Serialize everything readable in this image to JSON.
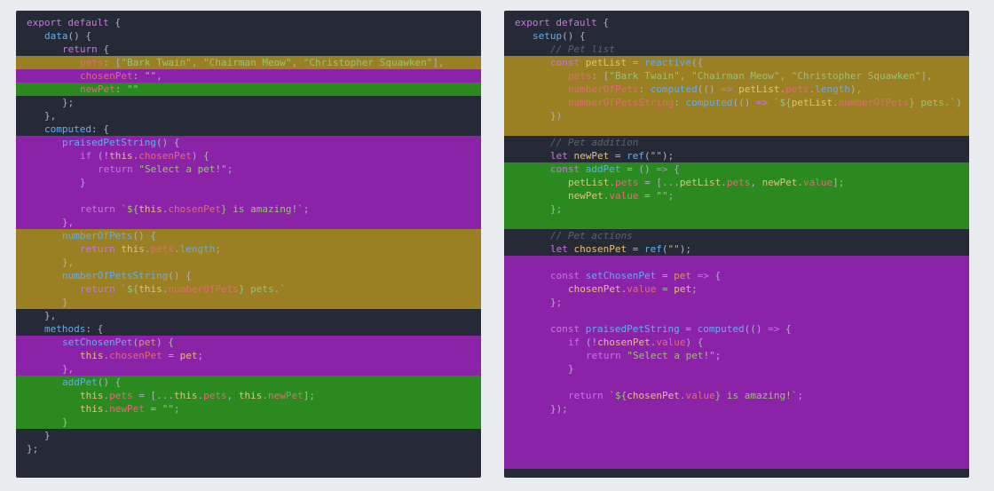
{
  "left": {
    "bands": [
      {
        "from": 3,
        "to": 3,
        "color": "hl-yellow"
      },
      {
        "from": 4,
        "to": 4,
        "color": "hl-purple"
      },
      {
        "from": 5,
        "to": 5,
        "color": "hl-green"
      },
      {
        "from": 9,
        "to": 15,
        "color": "hl-purple"
      },
      {
        "from": 16,
        "to": 18,
        "color": "hl-yellow"
      },
      {
        "from": 19,
        "to": 21,
        "color": "hl-yellow"
      },
      {
        "from": 24,
        "to": 26,
        "color": "hl-purple"
      },
      {
        "from": 27,
        "to": 30,
        "color": "hl-green"
      }
    ],
    "lines": [
      {
        "i": 4,
        "seg": [
          [
            "k",
            "export"
          ],
          [
            "p",
            " "
          ],
          [
            "k",
            "default"
          ],
          [
            "p",
            " {"
          ]
        ]
      },
      {
        "i": 24,
        "seg": [
          [
            "fn",
            "data"
          ],
          [
            "p",
            "() {"
          ]
        ]
      },
      {
        "i": 44,
        "seg": [
          [
            "k",
            "return"
          ],
          [
            "p",
            " {"
          ]
        ]
      },
      {
        "i": 64,
        "seg": [
          [
            "pr",
            "pets"
          ],
          [
            "p",
            ": ["
          ],
          [
            "s",
            "\"Bark Twain\""
          ],
          [
            "p",
            ", "
          ],
          [
            "s",
            "\"Chairman Meow\""
          ],
          [
            "p",
            ", "
          ],
          [
            "s",
            "\"Christopher Squawken\""
          ],
          [
            "p",
            "],"
          ]
        ]
      },
      {
        "i": 64,
        "seg": [
          [
            "pr",
            "chosenPet"
          ],
          [
            "p",
            ": "
          ],
          [
            "s",
            "\"\""
          ],
          [
            "p",
            ","
          ]
        ]
      },
      {
        "i": 64,
        "seg": [
          [
            "pr",
            "newPet"
          ],
          [
            "p",
            ": "
          ],
          [
            "s",
            "\"\""
          ]
        ]
      },
      {
        "i": 44,
        "seg": [
          [
            "p",
            "};"
          ]
        ]
      },
      {
        "i": 24,
        "seg": [
          [
            "p",
            "},"
          ]
        ]
      },
      {
        "i": 24,
        "seg": [
          [
            "fn",
            "computed"
          ],
          [
            "p",
            ": {"
          ]
        ]
      },
      {
        "i": 44,
        "seg": [
          [
            "fn",
            "praisedPetString"
          ],
          [
            "p",
            "() {"
          ]
        ]
      },
      {
        "i": 64,
        "seg": [
          [
            "k",
            "if"
          ],
          [
            "p",
            " (!"
          ],
          [
            "th",
            "this"
          ],
          [
            "p",
            "."
          ],
          [
            "pr",
            "chosenPet"
          ],
          [
            "p",
            ") {"
          ]
        ]
      },
      {
        "i": 84,
        "seg": [
          [
            "k",
            "return"
          ],
          [
            "p",
            " "
          ],
          [
            "s",
            "\"Select a pet!\""
          ],
          [
            "p",
            ";"
          ]
        ]
      },
      {
        "i": 64,
        "seg": [
          [
            "p",
            "}"
          ]
        ]
      },
      {
        "i": 64,
        "seg": [
          [
            "p",
            ""
          ]
        ]
      },
      {
        "i": 64,
        "seg": [
          [
            "k",
            "return"
          ],
          [
            "p",
            " "
          ],
          [
            "s",
            "`${"
          ],
          [
            "th",
            "this"
          ],
          [
            "p",
            "."
          ],
          [
            "pr",
            "chosenPet"
          ],
          [
            "s",
            "} is amazing!`"
          ],
          [
            "p",
            ";"
          ]
        ]
      },
      {
        "i": 44,
        "seg": [
          [
            "p",
            "},"
          ]
        ]
      },
      {
        "i": 44,
        "seg": [
          [
            "fn",
            "numberOfPets"
          ],
          [
            "p",
            "() {"
          ]
        ]
      },
      {
        "i": 64,
        "seg": [
          [
            "k",
            "return"
          ],
          [
            "p",
            " "
          ],
          [
            "th",
            "this"
          ],
          [
            "p",
            "."
          ],
          [
            "pr",
            "pets"
          ],
          [
            "p",
            "."
          ],
          [
            "fn",
            "length"
          ],
          [
            "p",
            ";"
          ]
        ]
      },
      {
        "i": 44,
        "seg": [
          [
            "p",
            "},"
          ]
        ]
      },
      {
        "i": 44,
        "seg": [
          [
            "fn",
            "numberOfPetsString"
          ],
          [
            "p",
            "() {"
          ]
        ]
      },
      {
        "i": 64,
        "seg": [
          [
            "k",
            "return"
          ],
          [
            "p",
            " "
          ],
          [
            "s",
            "`${"
          ],
          [
            "th",
            "this"
          ],
          [
            "p",
            "."
          ],
          [
            "pr",
            "numberOfPets"
          ],
          [
            "s",
            "} pets.`"
          ]
        ]
      },
      {
        "i": 44,
        "seg": [
          [
            "p",
            "}"
          ]
        ]
      },
      {
        "i": 24,
        "seg": [
          [
            "p",
            "},"
          ]
        ]
      },
      {
        "i": 24,
        "seg": [
          [
            "fn",
            "methods"
          ],
          [
            "p",
            ": {"
          ]
        ]
      },
      {
        "i": 44,
        "seg": [
          [
            "fn",
            "setChosenPet"
          ],
          [
            "p",
            "("
          ],
          [
            "n",
            "pet"
          ],
          [
            "p",
            ") {"
          ]
        ]
      },
      {
        "i": 64,
        "seg": [
          [
            "th",
            "this"
          ],
          [
            "p",
            "."
          ],
          [
            "pr",
            "chosenPet"
          ],
          [
            "p",
            " = "
          ],
          [
            "v",
            "pet"
          ],
          [
            "p",
            ";"
          ]
        ]
      },
      {
        "i": 44,
        "seg": [
          [
            "p",
            "},"
          ]
        ]
      },
      {
        "i": 44,
        "seg": [
          [
            "fn",
            "addPet"
          ],
          [
            "p",
            "() {"
          ]
        ]
      },
      {
        "i": 64,
        "seg": [
          [
            "th",
            "this"
          ],
          [
            "p",
            "."
          ],
          [
            "pr",
            "pets"
          ],
          [
            "p",
            " = [..."
          ],
          [
            "th",
            "this"
          ],
          [
            "p",
            "."
          ],
          [
            "pr",
            "pets"
          ],
          [
            "p",
            ", "
          ],
          [
            "th",
            "this"
          ],
          [
            "p",
            "."
          ],
          [
            "pr",
            "newPet"
          ],
          [
            "p",
            "];"
          ]
        ]
      },
      {
        "i": 64,
        "seg": [
          [
            "th",
            "this"
          ],
          [
            "p",
            "."
          ],
          [
            "pr",
            "newPet"
          ],
          [
            "p",
            " = "
          ],
          [
            "s",
            "\"\""
          ],
          [
            "p",
            ";"
          ]
        ]
      },
      {
        "i": 44,
        "seg": [
          [
            "p",
            "}"
          ]
        ]
      },
      {
        "i": 24,
        "seg": [
          [
            "p",
            "}"
          ]
        ]
      },
      {
        "i": 4,
        "seg": [
          [
            "p",
            "};"
          ]
        ]
      }
    ]
  },
  "right": {
    "bands": [
      {
        "from": 3,
        "to": 8,
        "color": "hl-yellow"
      },
      {
        "from": 11,
        "to": 15,
        "color": "hl-green"
      },
      {
        "from": 18,
        "to": 33,
        "color": "hl-purple"
      }
    ],
    "lines": [
      {
        "i": 4,
        "seg": [
          [
            "k",
            "export"
          ],
          [
            "p",
            " "
          ],
          [
            "k",
            "default"
          ],
          [
            "p",
            " {"
          ]
        ]
      },
      {
        "i": 24,
        "seg": [
          [
            "fn",
            "setup"
          ],
          [
            "p",
            "() {"
          ]
        ]
      },
      {
        "i": 44,
        "seg": [
          [
            "c",
            "// Pet list"
          ]
        ]
      },
      {
        "i": 44,
        "seg": [
          [
            "k",
            "const"
          ],
          [
            "p",
            " "
          ],
          [
            "v",
            "petList"
          ],
          [
            "p",
            " = "
          ],
          [
            "fn",
            "reactive"
          ],
          [
            "p",
            "({"
          ]
        ]
      },
      {
        "i": 64,
        "seg": [
          [
            "pr",
            "pets"
          ],
          [
            "p",
            ": ["
          ],
          [
            "s",
            "\"Bark Twain\""
          ],
          [
            "p",
            ", "
          ],
          [
            "s",
            "\"Chairman Meow\""
          ],
          [
            "p",
            ", "
          ],
          [
            "s",
            "\"Christopher Squawken\""
          ],
          [
            "p",
            "],"
          ]
        ]
      },
      {
        "i": 64,
        "seg": [
          [
            "pr",
            "numberOfPets"
          ],
          [
            "p",
            ": "
          ],
          [
            "fn",
            "computed"
          ],
          [
            "p",
            "(() "
          ],
          [
            "k",
            "=>"
          ],
          [
            "p",
            " "
          ],
          [
            "v",
            "petList"
          ],
          [
            "p",
            "."
          ],
          [
            "pr",
            "pets"
          ],
          [
            "p",
            "."
          ],
          [
            "fn",
            "length"
          ],
          [
            "p",
            "),"
          ]
        ]
      },
      {
        "i": 64,
        "seg": [
          [
            "pr",
            "numberOfPetsString"
          ],
          [
            "p",
            ": "
          ],
          [
            "fn",
            "computed"
          ],
          [
            "p",
            "(() "
          ],
          [
            "k",
            "=>"
          ],
          [
            "p",
            " "
          ],
          [
            "s",
            "`${"
          ],
          [
            "v",
            "petList"
          ],
          [
            "p",
            "."
          ],
          [
            "pr",
            "numberOfPets"
          ],
          [
            "s",
            "} pets.`"
          ],
          [
            "p",
            ")"
          ]
        ]
      },
      {
        "i": 44,
        "seg": [
          [
            "p",
            "})"
          ]
        ]
      },
      {
        "i": 44,
        "seg": [
          [
            "p",
            ""
          ]
        ]
      },
      {
        "i": 44,
        "seg": [
          [
            "c",
            "// Pet addition"
          ]
        ]
      },
      {
        "i": 44,
        "seg": [
          [
            "k",
            "let"
          ],
          [
            "p",
            " "
          ],
          [
            "v",
            "newPet"
          ],
          [
            "p",
            " = "
          ],
          [
            "fn",
            "ref"
          ],
          [
            "p",
            "("
          ],
          [
            "s",
            "\"\""
          ],
          [
            "p",
            ");"
          ]
        ]
      },
      {
        "i": 44,
        "seg": [
          [
            "k",
            "const"
          ],
          [
            "p",
            " "
          ],
          [
            "fn",
            "addPet"
          ],
          [
            "p",
            " = () "
          ],
          [
            "k",
            "=>"
          ],
          [
            "p",
            " {"
          ]
        ]
      },
      {
        "i": 64,
        "seg": [
          [
            "v",
            "petList"
          ],
          [
            "p",
            "."
          ],
          [
            "pr",
            "pets"
          ],
          [
            "p",
            " = [..."
          ],
          [
            "v",
            "petList"
          ],
          [
            "p",
            "."
          ],
          [
            "pr",
            "pets"
          ],
          [
            "p",
            ", "
          ],
          [
            "v",
            "newPet"
          ],
          [
            "p",
            "."
          ],
          [
            "pr",
            "value"
          ],
          [
            "p",
            "];"
          ]
        ]
      },
      {
        "i": 64,
        "seg": [
          [
            "v",
            "newPet"
          ],
          [
            "p",
            "."
          ],
          [
            "pr",
            "value"
          ],
          [
            "p",
            " = "
          ],
          [
            "s",
            "\"\""
          ],
          [
            "p",
            ";"
          ]
        ]
      },
      {
        "i": 44,
        "seg": [
          [
            "p",
            "};"
          ]
        ]
      },
      {
        "i": 44,
        "seg": [
          [
            "p",
            ""
          ]
        ]
      },
      {
        "i": 44,
        "seg": [
          [
            "c",
            "// Pet actions"
          ]
        ]
      },
      {
        "i": 44,
        "seg": [
          [
            "k",
            "let"
          ],
          [
            "p",
            " "
          ],
          [
            "v",
            "chosenPet"
          ],
          [
            "p",
            " = "
          ],
          [
            "fn",
            "ref"
          ],
          [
            "p",
            "("
          ],
          [
            "s",
            "\"\""
          ],
          [
            "p",
            ");"
          ]
        ]
      },
      {
        "i": 44,
        "seg": [
          [
            "p",
            ""
          ]
        ]
      },
      {
        "i": 44,
        "seg": [
          [
            "k",
            "const"
          ],
          [
            "p",
            " "
          ],
          [
            "fn",
            "setChosenPet"
          ],
          [
            "p",
            " = "
          ],
          [
            "n",
            "pet"
          ],
          [
            "p",
            " "
          ],
          [
            "k",
            "=>"
          ],
          [
            "p",
            " {"
          ]
        ]
      },
      {
        "i": 64,
        "seg": [
          [
            "v",
            "chosenPet"
          ],
          [
            "p",
            "."
          ],
          [
            "pr",
            "value"
          ],
          [
            "p",
            " = "
          ],
          [
            "v",
            "pet"
          ],
          [
            "p",
            ";"
          ]
        ]
      },
      {
        "i": 44,
        "seg": [
          [
            "p",
            "};"
          ]
        ]
      },
      {
        "i": 44,
        "seg": [
          [
            "p",
            ""
          ]
        ]
      },
      {
        "i": 44,
        "seg": [
          [
            "k",
            "const"
          ],
          [
            "p",
            " "
          ],
          [
            "fn",
            "praisedPetString"
          ],
          [
            "p",
            " = "
          ],
          [
            "fn",
            "computed"
          ],
          [
            "p",
            "(() "
          ],
          [
            "k",
            "=>"
          ],
          [
            "p",
            " {"
          ]
        ]
      },
      {
        "i": 64,
        "seg": [
          [
            "k",
            "if"
          ],
          [
            "p",
            " (!"
          ],
          [
            "v",
            "chosenPet"
          ],
          [
            "p",
            "."
          ],
          [
            "pr",
            "value"
          ],
          [
            "p",
            ") {"
          ]
        ]
      },
      {
        "i": 84,
        "seg": [
          [
            "k",
            "return"
          ],
          [
            "p",
            " "
          ],
          [
            "s",
            "\"Select a pet!\""
          ],
          [
            "p",
            ";"
          ]
        ]
      },
      {
        "i": 64,
        "seg": [
          [
            "p",
            "}"
          ]
        ]
      },
      {
        "i": 64,
        "seg": [
          [
            "p",
            ""
          ]
        ]
      },
      {
        "i": 64,
        "seg": [
          [
            "k",
            "return"
          ],
          [
            "p",
            " "
          ],
          [
            "s",
            "`${"
          ],
          [
            "v",
            "chosenPet"
          ],
          [
            "p",
            "."
          ],
          [
            "pr",
            "value"
          ],
          [
            "s",
            "} is amazing!`"
          ],
          [
            "p",
            ";"
          ]
        ]
      },
      {
        "i": 44,
        "seg": [
          [
            "p",
            "});"
          ]
        ]
      }
    ]
  }
}
